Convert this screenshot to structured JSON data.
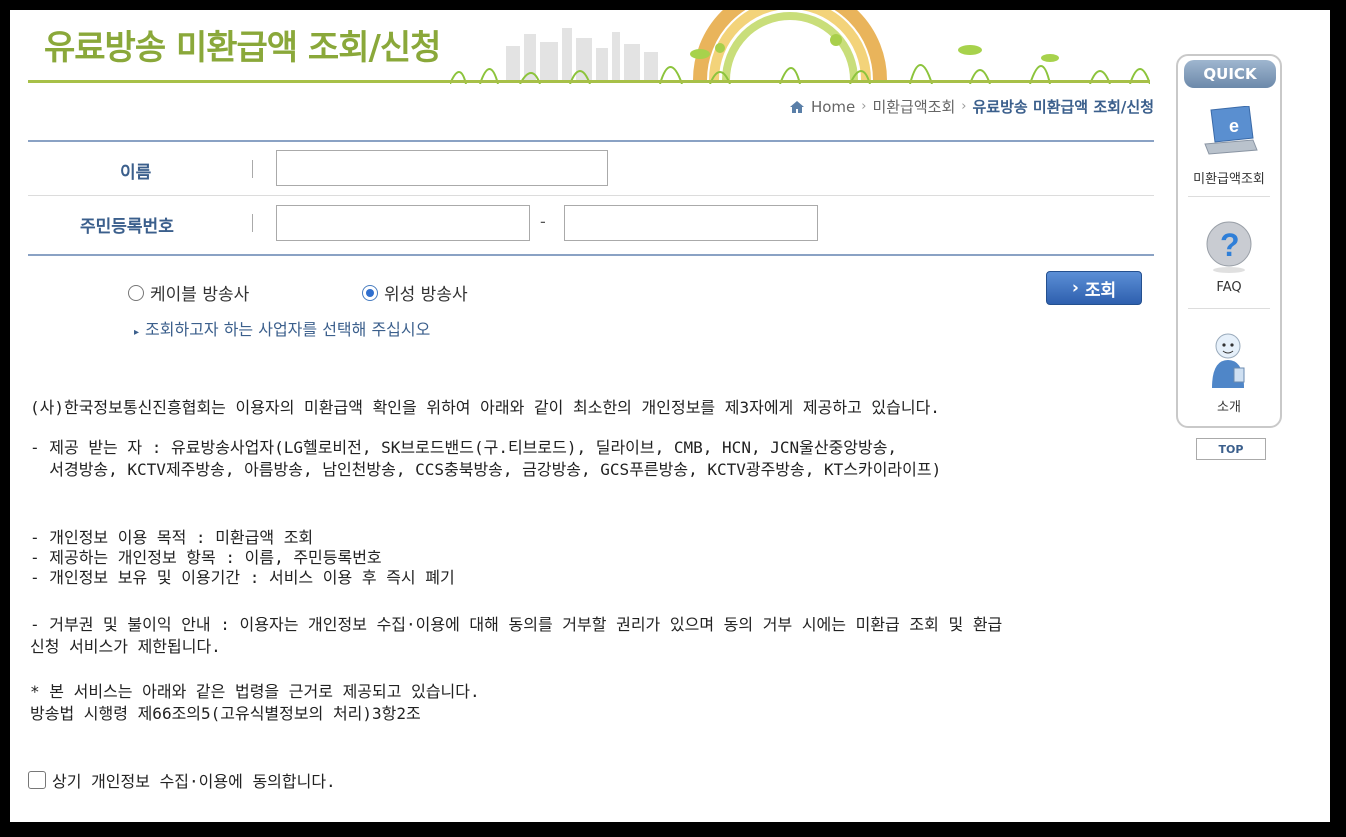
{
  "header": {
    "title": "유료방송 미환급액 조회/신청"
  },
  "breadcrumb": {
    "home": "Home",
    "level1": "미환급액조회",
    "current": "유료방송 미환급액 조회/신청"
  },
  "form": {
    "name_label": "이름",
    "name_value": "",
    "rrn_label": "주민등록번호",
    "rrn_dash": "-",
    "rrn_first_value": "",
    "rrn_second_value": ""
  },
  "options": {
    "cable_label": "케이블 방송사",
    "satellite_label": "위성 방송사",
    "selected": "satellite",
    "search_button": "조회",
    "hint": "조회하고자 하는 사업자를 선택해 주십시오"
  },
  "notice": {
    "intro": "(사)한국정보통신진흥협회는 이용자의 미환급액 확인을 위하여 아래와 같이 최소한의 개인정보를 제3자에게 제공하고 있습니다.",
    "recipients_line1": "- 제공 받는 자 : 유료방송사업자(LG헬로비전, SK브로드밴드(구.티브로드), 딜라이브, CMB, HCN, JCN울산중앙방송,",
    "recipients_line2": "  서경방송, KCTV제주방송, 아름방송, 남인천방송, CCS충북방송, 금강방송, GCS푸른방송, KCTV광주방송, KT스카이라이프)",
    "purpose": "- 개인정보 이용 목적 : 미환급액 조회",
    "items": "- 제공하는 개인정보 항목 : 이름, 주민등록번호",
    "period": "- 개인정보 보유 및 이용기간 : 서비스 이용 후 즉시 폐기",
    "refusal_line1": "- 거부권 및 불이익 안내 : 이용자는 개인정보 수집·이용에 대해 동의를 거부할 권리가 있으며 동의 거부 시에는 미환급 조회 및 환급",
    "refusal_line2": "신청 서비스가 제한됩니다.",
    "law_line1": "* 본 서비스는 아래와 같은 법령을 근거로 제공되고 있습니다.",
    "law_line2": "방송법 시행령 제66조의5(고유식별정보의 처리)3항2조"
  },
  "agree": {
    "label": "상기 개인정보 수집·이용에 동의합니다.",
    "checked": false
  },
  "quick": {
    "title": "QUICK",
    "item1": "미환급액조회",
    "item1_icon": "laptop-icon",
    "item2": "FAQ",
    "item2_icon": "question-icon",
    "item3": "소개",
    "item3_icon": "person-icon",
    "top": "TOP"
  }
}
